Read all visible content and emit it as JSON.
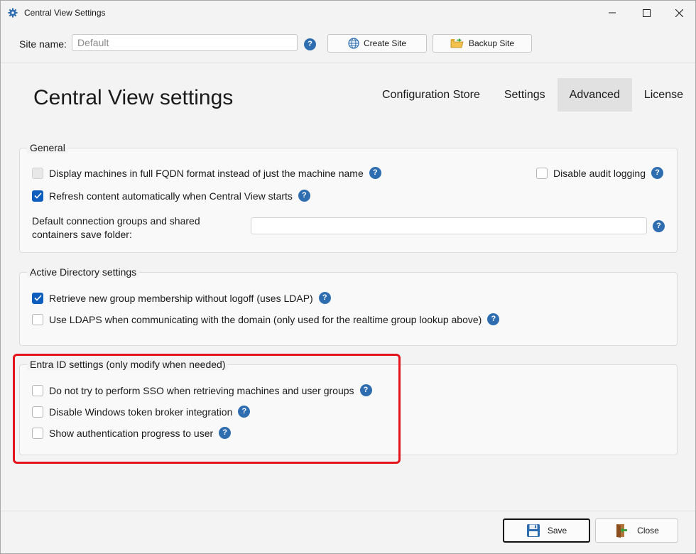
{
  "window": {
    "title": "Central View Settings"
  },
  "site": {
    "label": "Site name:",
    "value": "Default",
    "create_label": "Create Site",
    "backup_label": "Backup Site"
  },
  "header": {
    "title": "Central View settings",
    "tabs": [
      {
        "label": "Configuration Store",
        "active": false
      },
      {
        "label": "Settings",
        "active": false
      },
      {
        "label": "Advanced",
        "active": true
      },
      {
        "label": "License",
        "active": false
      }
    ]
  },
  "general": {
    "title": "General",
    "fqdn": {
      "label": "Display machines in full FQDN format instead of just the machine name",
      "checked": false,
      "disabled": true
    },
    "audit": {
      "label": "Disable audit logging",
      "checked": false
    },
    "refresh": {
      "label": "Refresh content automatically when Central View starts",
      "checked": true
    },
    "folder_label_1": "Default connection groups and shared",
    "folder_label_2": "containers save folder:",
    "folder_value": ""
  },
  "ad": {
    "title": "Active Directory settings",
    "ldap": {
      "label": "Retrieve new group membership without logoff (uses LDAP)",
      "checked": true
    },
    "ldaps": {
      "label": "Use LDAPS when communicating with the domain (only used for the realtime group lookup above)",
      "checked": false
    }
  },
  "entra": {
    "title": "Entra ID settings (only modify when needed)",
    "sso": {
      "label": "Do not try to perform SSO when retrieving machines and user groups",
      "checked": false
    },
    "broker": {
      "label": "Disable Windows token broker integration",
      "checked": false
    },
    "progress": {
      "label": "Show authentication progress to user",
      "checked": false
    }
  },
  "footer": {
    "save_label": "Save",
    "close_label": "Close"
  },
  "colors": {
    "accent": "#0e5fbd",
    "help": "#2f6db1",
    "highlight": "#e3141b"
  }
}
